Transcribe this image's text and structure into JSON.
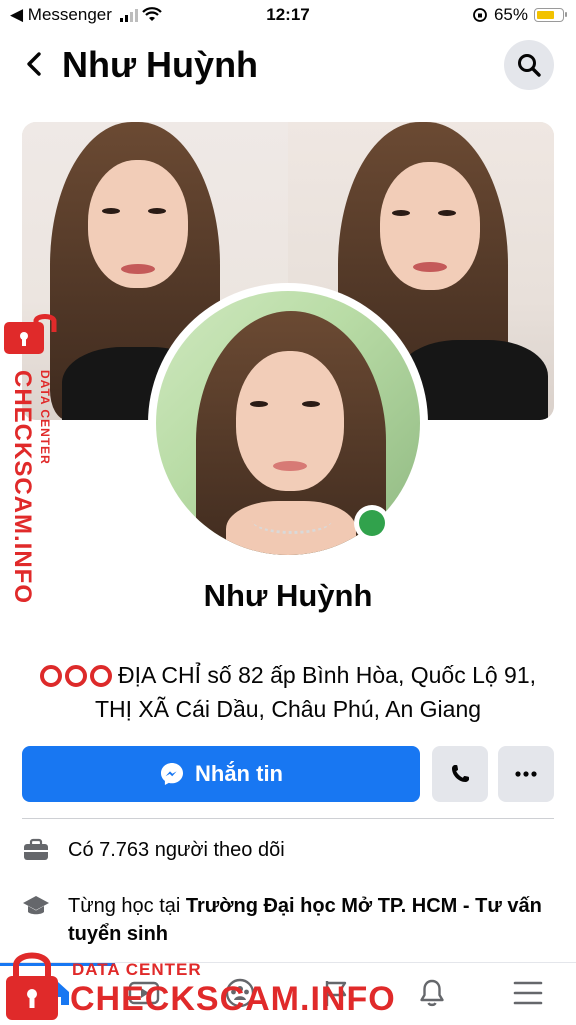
{
  "status_bar": {
    "carrier": "◀ Messenger",
    "time": "12:17",
    "battery_percent": "65%",
    "battery_level": 0.65
  },
  "header": {
    "title": "Như Huỳnh",
    "back_icon": "chevron-left-icon",
    "search_icon": "search-icon"
  },
  "profile": {
    "name": "Như Huỳnh",
    "bio": "ĐỊA CHỈ số 82 ấp Bình Hòa, Quốc Lộ 91, THỊ XÃ Cái Dầu, Châu Phú, An Giang",
    "online": true
  },
  "actions": {
    "message_label": "Nhắn tin",
    "call_icon": "phone-icon",
    "more_icon": "more-icon"
  },
  "info": {
    "followers_text": "Có 7.763 người theo dõi",
    "education_prefix": "Từng học tại ",
    "education_school": "Trường Đại học Mở TP. HCM - Tư vấn tuyển sinh"
  },
  "nav": {
    "items": [
      "home-icon",
      "video-icon",
      "groups-icon",
      "pages-flag-icon",
      "bell-icon",
      "menu-icon"
    ]
  },
  "watermark": {
    "brand": "CHECKSCAM.INFO",
    "sub": "DATA CENTER"
  },
  "colors": {
    "accent": "#1877f2",
    "online": "#31a24c",
    "watermark": "#e02a2a"
  }
}
